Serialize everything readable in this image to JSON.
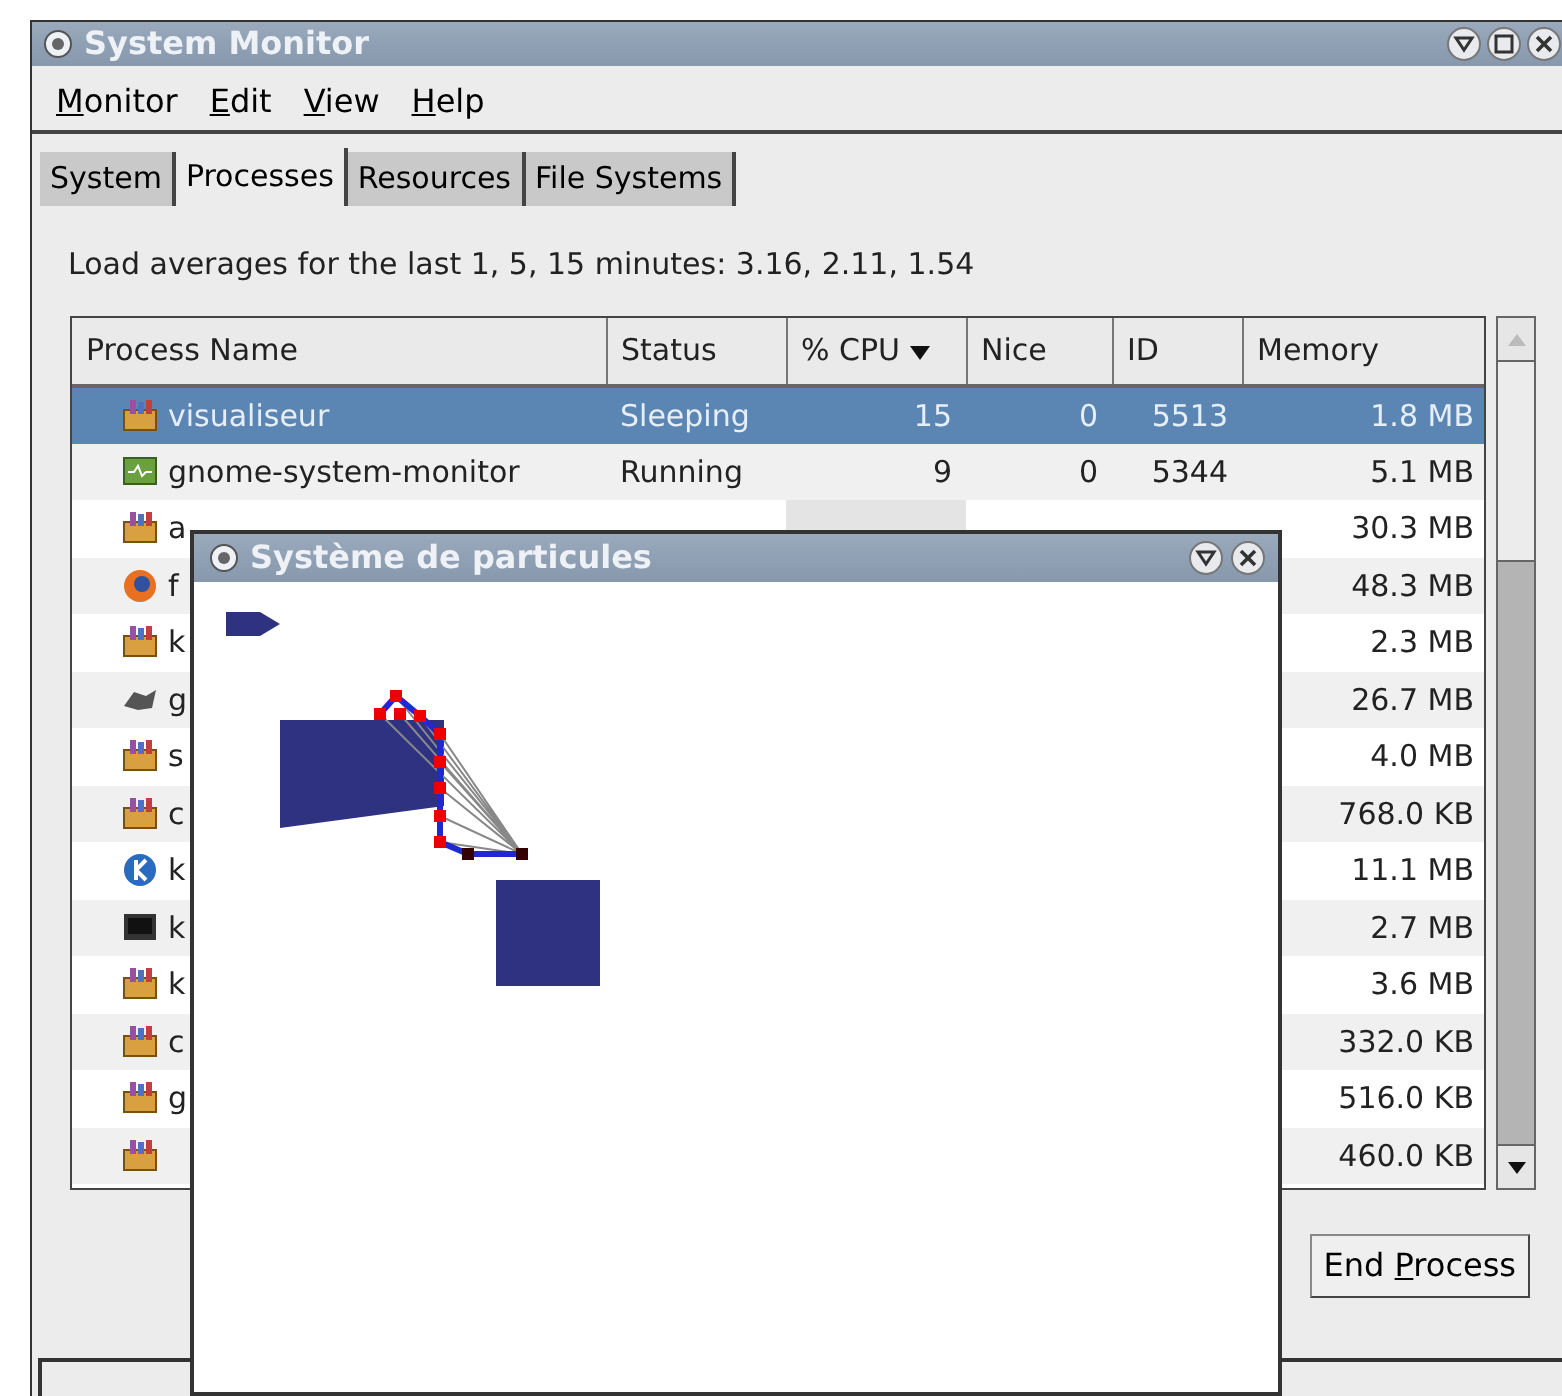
{
  "window": {
    "title": "System Monitor"
  },
  "menu": [
    {
      "key": "M",
      "after": "onitor"
    },
    {
      "key": "E",
      "after": "dit"
    },
    {
      "key": "V",
      "after": "iew"
    },
    {
      "key": "H",
      "after": "elp"
    }
  ],
  "tabs": [
    {
      "label": "System",
      "selected": false
    },
    {
      "label": "Processes",
      "selected": true
    },
    {
      "label": "Resources",
      "selected": false
    },
    {
      "label": "File Systems",
      "selected": false
    }
  ],
  "load_averages": "Load averages for the last 1, 5, 15 minutes: 3.16, 2.11, 1.54",
  "table": {
    "columns": [
      {
        "label": "Process Name",
        "sorted": false
      },
      {
        "label": "Status",
        "sorted": false
      },
      {
        "label": "% CPU",
        "sorted": true
      },
      {
        "label": "Nice",
        "sorted": false
      },
      {
        "label": "ID",
        "sorted": false
      },
      {
        "label": "Memory",
        "sorted": false
      }
    ],
    "rows": [
      {
        "kind": "package",
        "name": "visualiseur",
        "status": "Sleeping",
        "cpu": "15",
        "nice": "0",
        "id": "5513",
        "memory": "1.8 MB",
        "selected": true
      },
      {
        "kind": "monitor",
        "name": "gnome-system-monitor",
        "status": "Running",
        "cpu": "9",
        "nice": "0",
        "id": "5344",
        "memory": "5.1 MB",
        "selected": false
      },
      {
        "kind": "package",
        "name": "a",
        "memory": "30.3 MB",
        "selected": false
      },
      {
        "kind": "globe",
        "name": "f",
        "memory": "48.3 MB",
        "selected": false
      },
      {
        "kind": "package",
        "name": "k",
        "memory": "2.3 MB",
        "selected": false
      },
      {
        "kind": "animal",
        "name": "g",
        "memory": "26.7 MB",
        "selected": false
      },
      {
        "kind": "package",
        "name": "s",
        "memory": "4.0 MB",
        "selected": false
      },
      {
        "kind": "package",
        "name": "c",
        "memory": "768.0 KB",
        "selected": false
      },
      {
        "kind": "kbadge",
        "name": "k",
        "memory": "11.1 MB",
        "selected": false
      },
      {
        "kind": "terminal",
        "name": "k",
        "memory": "2.7 MB",
        "selected": false
      },
      {
        "kind": "package",
        "name": "k",
        "memory": "3.6 MB",
        "selected": false
      },
      {
        "kind": "package",
        "name": "c",
        "memory": "332.0 KB",
        "selected": false
      },
      {
        "kind": "package",
        "name": "g",
        "memory": "516.0 KB",
        "selected": false
      },
      {
        "kind": "package",
        "memory": "460.0 KB",
        "selected": false
      }
    ]
  },
  "end_button": {
    "before": "End ",
    "key": "P",
    "after": "rocess"
  },
  "dialog": {
    "title": "Système de particules"
  }
}
